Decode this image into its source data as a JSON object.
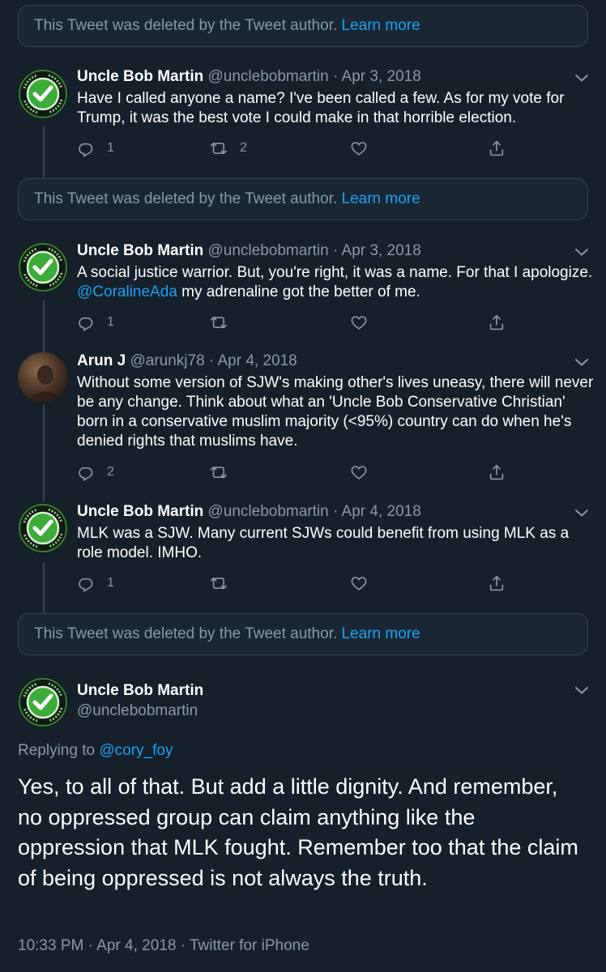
{
  "deleted_notice": {
    "text": "This Tweet was deleted by the Tweet author.",
    "link": "Learn more"
  },
  "tweets": [
    {
      "name": "Uncle Bob Martin",
      "handle": "@unclebobmartin",
      "date": "· Apr 3, 2018",
      "text": "Have I called anyone a name?  I've been called a few.  As for my vote for Trump, it was the best vote I could make in that horrible election.",
      "replies": "1",
      "retweets": "2",
      "likes": ""
    },
    {
      "name": "Uncle Bob Martin",
      "handle": "@unclebobmartin",
      "date": "· Apr 3, 2018",
      "text_before": "A social justice warrior.  But, you're right, it was a name.  For that I apologize.  ",
      "mention": "@CoralineAda",
      "text_after": " my adrenaline got the better of me.",
      "replies": "1",
      "retweets": "",
      "likes": ""
    },
    {
      "name": "Arun J",
      "handle": "@arunkj78",
      "date": "· Apr 4, 2018",
      "text": "Without some version of SJW's making other's lives uneasy, there will never be any change. Think about what an 'Uncle Bob Conservative Christian' born in a conservative muslim majority (<95%) country can do when he's denied rights that muslims have.",
      "replies": "2",
      "retweets": "",
      "likes": ""
    },
    {
      "name": "Uncle Bob Martin",
      "handle": "@unclebobmartin",
      "date": "· Apr 4, 2018",
      "text": "MLK was a SJW.  Many current SJWs could benefit from using MLK as a role model.  IMHO.",
      "replies": "1",
      "retweets": "",
      "likes": ""
    }
  ],
  "main_tweet": {
    "name": "Uncle Bob Martin",
    "handle": "@unclebobmartin",
    "replying_prefix": "Replying to",
    "replying_to": "@cory_foy",
    "text": "Yes, to all of that. But add a little dignity.  And remember, no oppressed group can claim anything like the oppression that MLK fought. Remember too that the claim of being oppressed is not always the truth.",
    "meta": "10:33 PM · Apr 4, 2018 · Twitter for iPhone"
  },
  "avatar_badge_text": "CLEAN CODE",
  "colors": {
    "background": "#15202b",
    "accent": "#1da1f2",
    "muted": "#8899a6",
    "border": "#38444d"
  },
  "icons": [
    "reply-icon",
    "retweet-icon",
    "like-icon",
    "share-icon",
    "chevron-down-icon"
  ]
}
